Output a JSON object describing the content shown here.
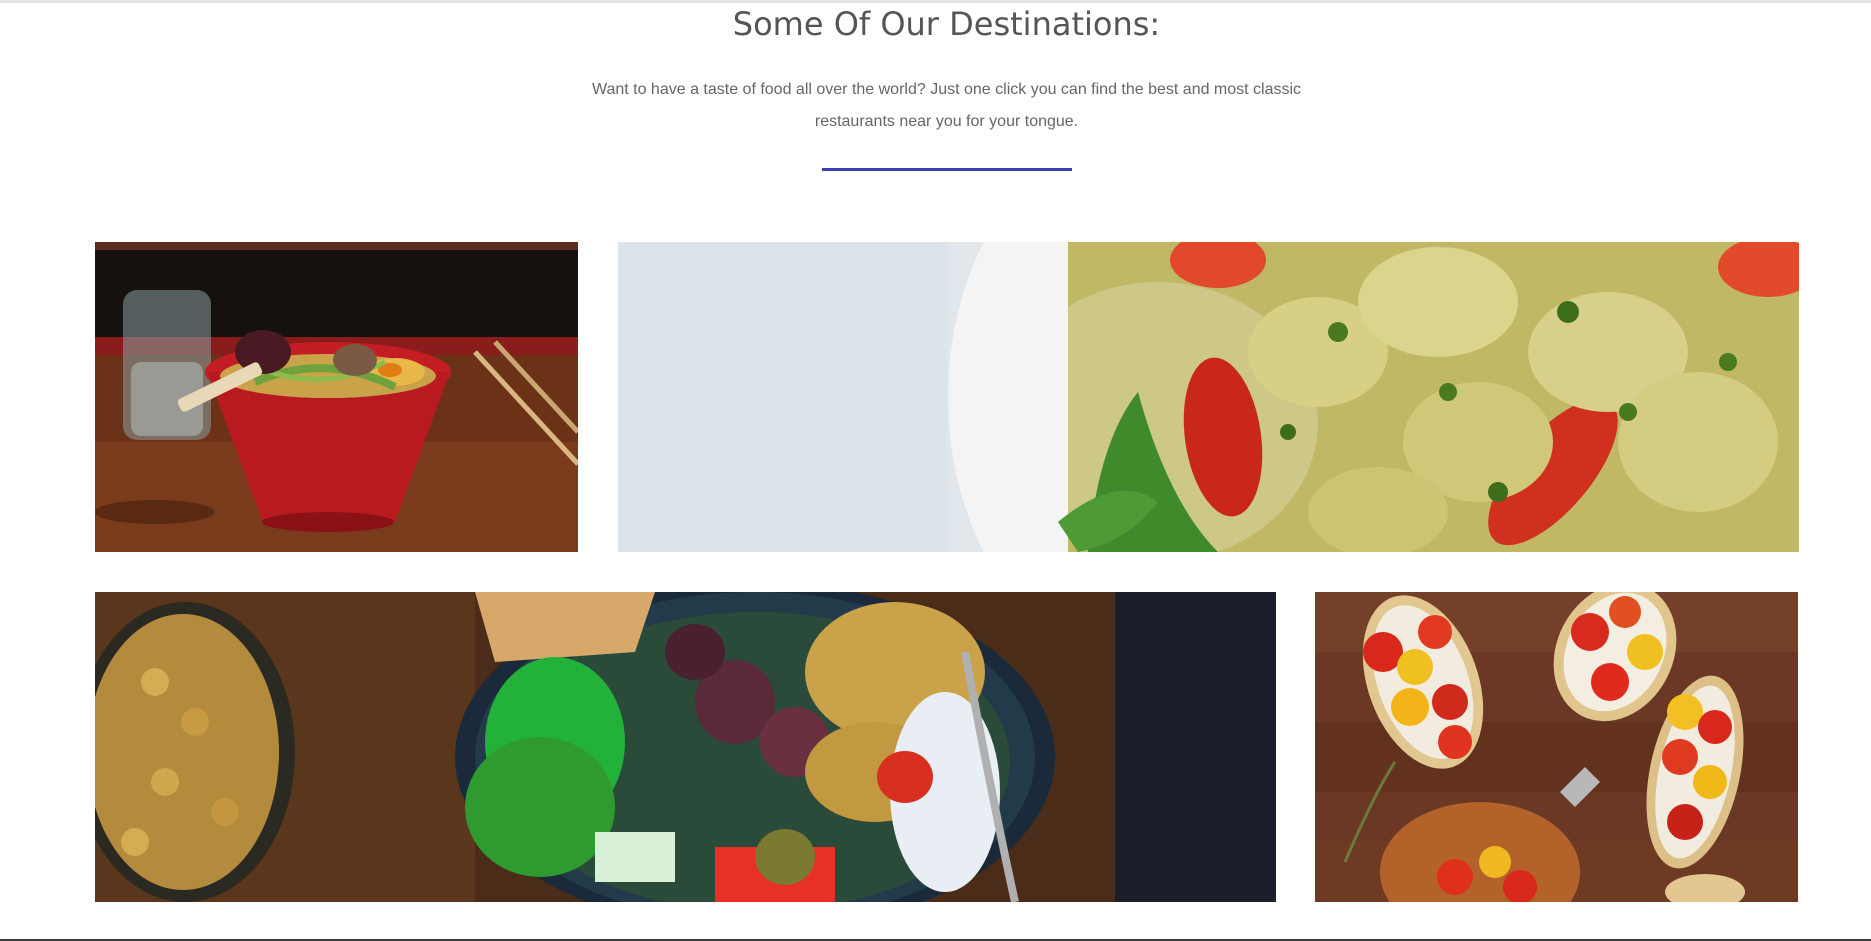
{
  "section": {
    "title": "Some Of Our Destinations:",
    "intro_line_1": "Want to have a taste of food all over the world? Just one click you can find the best and most classic",
    "intro_line_2": "restaurants near you for your tongue."
  },
  "colors": {
    "accent": "#3a3fae",
    "heading": "#555555",
    "body_text": "#666666"
  },
  "gallery": [
    {
      "id": "ramen",
      "image": "ramen-bowl-photo"
    },
    {
      "id": "pasta",
      "image": "pesto-farfalle-photo"
    },
    {
      "id": "bowl",
      "image": "chickpea-salad-bowl-photo"
    },
    {
      "id": "toast",
      "image": "tomato-bruschetta-photo"
    }
  ]
}
